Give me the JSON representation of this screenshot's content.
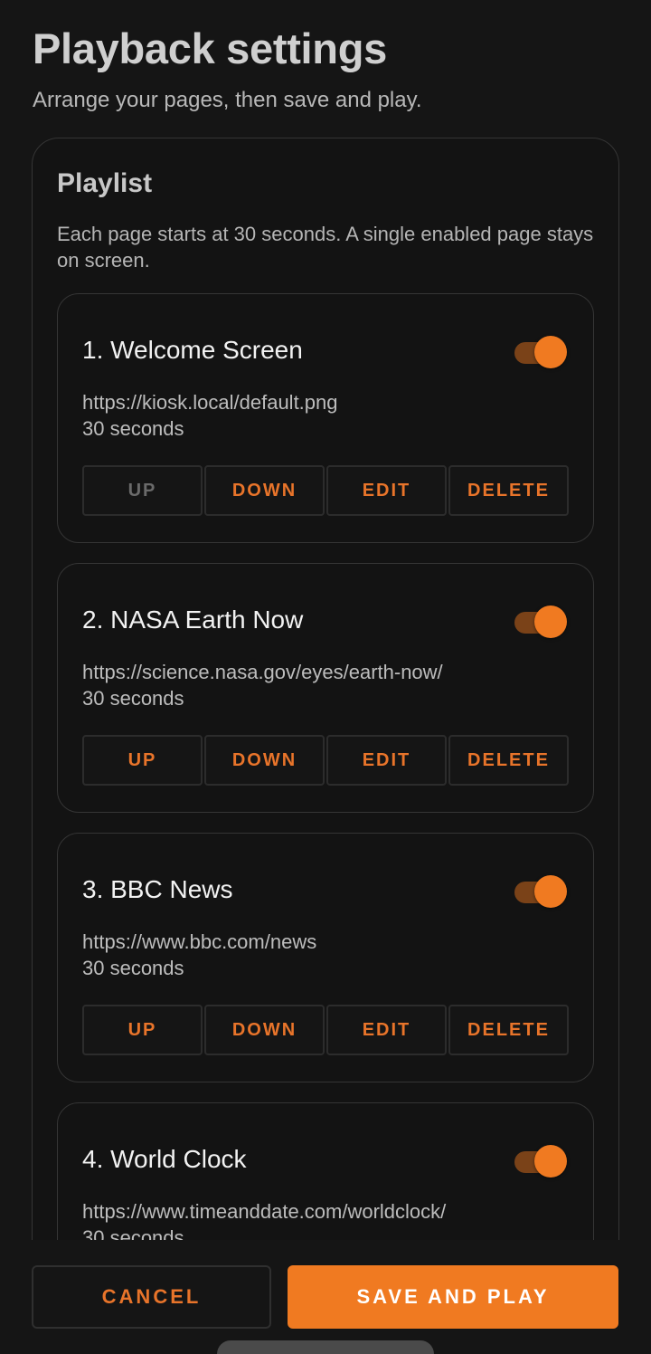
{
  "header": {
    "title": "Playback settings",
    "subtitle": "Arrange your pages, then save and play."
  },
  "playlist": {
    "title": "Playlist",
    "description": "Each page starts at 30 seconds. A single enabled page stays on screen.",
    "buttons": {
      "up": "UP",
      "down": "DOWN",
      "edit": "EDIT",
      "delete": "DELETE"
    },
    "items": [
      {
        "title": "1. Welcome Screen",
        "url": "https://kiosk.local/default.png",
        "duration": "30 seconds",
        "enabled": true,
        "up_disabled": true
      },
      {
        "title": "2. NASA Earth Now",
        "url": "https://science.nasa.gov/eyes/earth-now/",
        "duration": "30 seconds",
        "enabled": true,
        "up_disabled": false
      },
      {
        "title": "3. BBC News",
        "url": "https://www.bbc.com/news",
        "duration": "30 seconds",
        "enabled": true,
        "up_disabled": false
      },
      {
        "title": "4. World Clock",
        "url": "https://www.timeanddate.com/worldclock/",
        "duration": "30 seconds",
        "enabled": true,
        "up_disabled": false
      }
    ]
  },
  "footer": {
    "cancel_label": "CANCEL",
    "save_label": "SAVE AND PLAY"
  },
  "colors": {
    "accent": "#f07a21",
    "background": "#151515",
    "toggle_track": "#7a4218"
  }
}
